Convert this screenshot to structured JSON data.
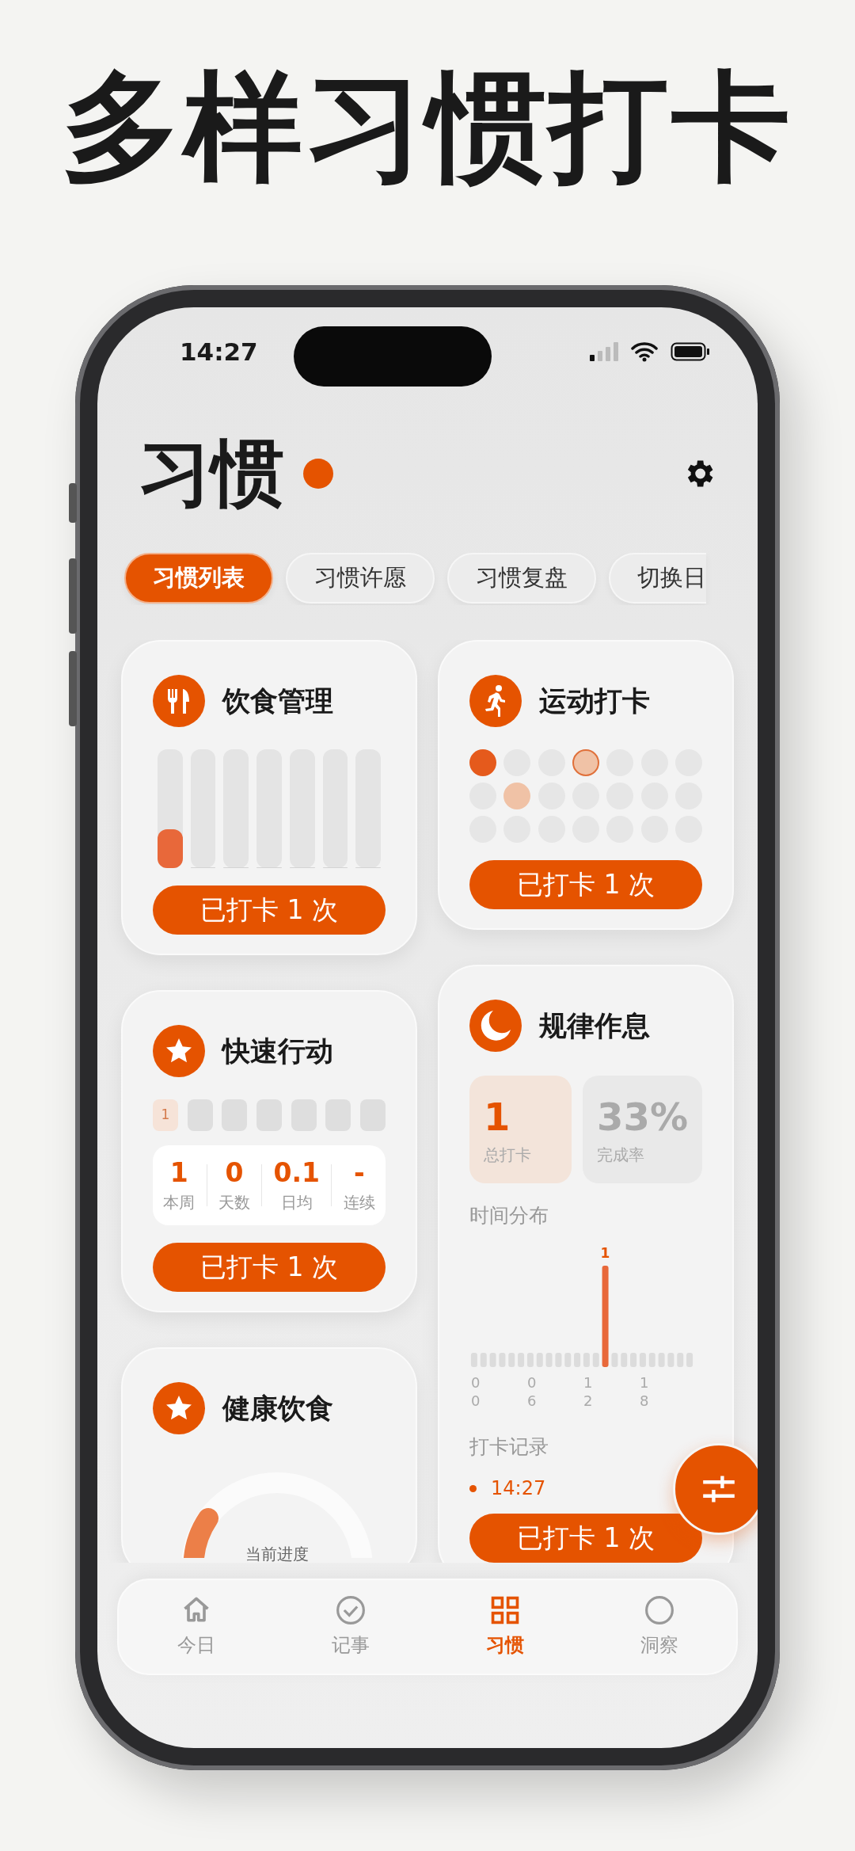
{
  "headline": "多样习惯打卡",
  "status_bar": {
    "time": "14:27"
  },
  "header": {
    "title": "习惯"
  },
  "tabs": [
    {
      "label": "习惯列表",
      "selected": true
    },
    {
      "label": "习惯许愿",
      "selected": false
    },
    {
      "label": "习惯复盘",
      "selected": false
    },
    {
      "label": "切换日",
      "selected": false
    }
  ],
  "card_columns": [
    {
      "cards": [
        {
          "kind": "bars",
          "title": "饮食管理",
          "bars": [
            {
              "level": 0.33
            },
            {
              "level": 0
            },
            {
              "level": 0
            },
            {
              "level": 0
            },
            {
              "level": 0
            },
            {
              "level": 0
            },
            {
              "level": 0
            }
          ],
          "button": "已打卡 1 次"
        },
        {
          "kind": "streak",
          "title": "快速行动",
          "days": [
            {
              "label": "1",
              "marked": true
            },
            {
              "marked": false
            },
            {
              "marked": false
            },
            {
              "marked": false
            },
            {
              "marked": false
            },
            {
              "marked": false
            },
            {
              "marked": false
            }
          ],
          "stats": [
            {
              "value": "1",
              "label": "本周"
            },
            {
              "value": "0",
              "label": "天数"
            },
            {
              "value": "0.1",
              "label": "日均"
            },
            {
              "value": "-",
              "label": "连续"
            }
          ],
          "button": "已打卡 1 次"
        },
        {
          "kind": "ring",
          "title": "健康饮食",
          "ring": {
            "caption": "当前进度"
          }
        }
      ]
    },
    {
      "cards": [
        {
          "kind": "dots",
          "title": "运动打卡",
          "dots": [
            {
              "kind": "done"
            },
            {
              "kind": "empty"
            },
            {
              "kind": "empty"
            },
            {
              "kind": "today"
            },
            {
              "kind": "empty"
            },
            {
              "kind": "empty"
            },
            {
              "kind": "empty"
            },
            {
              "kind": "empty"
            },
            {
              "kind": "partial"
            },
            {
              "kind": "empty"
            },
            {
              "kind": "empty"
            },
            {
              "kind": "empty"
            },
            {
              "kind": "empty"
            },
            {
              "kind": "empty"
            },
            {
              "kind": "empty"
            },
            {
              "kind": "empty"
            },
            {
              "kind": "empty"
            },
            {
              "kind": "empty"
            },
            {
              "kind": "empty"
            },
            {
              "kind": "empty"
            },
            {
              "kind": "empty"
            }
          ],
          "button": "已打卡 1 次"
        },
        {
          "kind": "schedule",
          "title": "规律作息",
          "tiles": [
            {
              "value": "1",
              "label": "总打卡",
              "highlighted": true
            },
            {
              "value": "33%",
              "label": "完成率",
              "highlighted": false
            }
          ],
          "chart_title": "时间分布",
          "hour_bars": [
            {
              "active": false
            },
            {
              "active": false
            },
            {
              "active": false
            },
            {
              "active": false
            },
            {
              "active": false
            },
            {
              "active": false
            },
            {
              "active": false
            },
            {
              "active": false
            },
            {
              "active": false
            },
            {
              "active": false
            },
            {
              "active": false
            },
            {
              "active": false
            },
            {
              "active": false
            },
            {
              "active": false
            },
            {
              "active": true
            },
            {
              "active": false
            },
            {
              "active": false
            },
            {
              "active": false
            },
            {
              "active": false
            },
            {
              "active": false
            },
            {
              "active": false
            },
            {
              "active": false
            },
            {
              "active": false
            },
            {
              "active": false
            }
          ],
          "bar_label": "1",
          "ticks": [
            "00",
            "06",
            "12",
            "18"
          ],
          "records_title": "打卡记录",
          "records": [
            "14:27"
          ],
          "button": "已打卡 1 次"
        }
      ]
    }
  ],
  "nav": [
    {
      "label": "今日",
      "selected": false
    },
    {
      "label": "记事",
      "selected": false
    },
    {
      "label": "习惯",
      "selected": true
    },
    {
      "label": "洞察",
      "selected": false
    }
  ]
}
